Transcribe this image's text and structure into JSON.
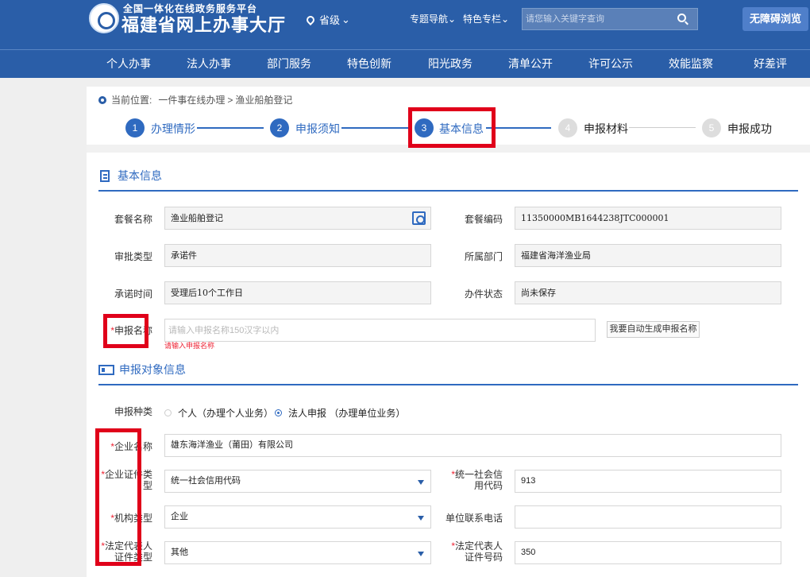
{
  "header": {
    "title_small": "全国一体化在线政务服务平台",
    "title_big": "福建省网上办事大厅",
    "region": "省级",
    "nav_topic": "专题导航",
    "nav_special": "特色专栏",
    "search_placeholder": "请您输入关键字查询",
    "accessibility": "无障碍浏览"
  },
  "main_nav": [
    "个人办事",
    "法人办事",
    "部门服务",
    "特色创新",
    "阳光政务",
    "清单公开",
    "许可公示",
    "效能监察",
    "好差评"
  ],
  "breadcrumb": {
    "prefix": "当前位置:",
    "path1": "一件事在线办理",
    "sep": ">",
    "path2": "渔业船舶登记"
  },
  "steps": [
    {
      "num": "1",
      "label": "办理情形"
    },
    {
      "num": "2",
      "label": "申报须知"
    },
    {
      "num": "3",
      "label": "基本信息"
    },
    {
      "num": "4",
      "label": "申报材料"
    },
    {
      "num": "5",
      "label": "申报成功"
    }
  ],
  "basic": {
    "title": "基本信息",
    "package_name_label": "套餐名称",
    "package_name": "渔业船舶登记",
    "package_code_label": "套餐编码",
    "package_code": "11350000MB1644238JTC000001",
    "approval_type_label": "审批类型",
    "approval_type": "承诺件",
    "department_label": "所属部门",
    "department": "福建省海洋渔业局",
    "promise_time_label": "承诺时间",
    "promise_time": "受理后10个工作日",
    "status_label": "办件状态",
    "status": "尚未保存",
    "apply_name_label": "申报名称",
    "apply_name_placeholder": "请输入申报名称150汉字以内",
    "apply_name_error": "请输入申报名称",
    "auto_generate": "我要自动生成申报名称"
  },
  "applicant": {
    "title": "申报对象信息",
    "type_label": "申报种类",
    "type_personal": "个人（办理个人业务）",
    "type_legal": "法人申报 （办理单位业务）",
    "company_label": "企业名称",
    "company": "雄东海洋渔业（莆田）有限公司",
    "cert_type_label1": "企业证件类",
    "cert_type_label2": "型",
    "cert_type": "统一社会信用代码",
    "credit_code_label1": "统一社会信",
    "credit_code_label2": "用代码",
    "credit_code": "913",
    "org_type_label": "机构类型",
    "org_type": "企业",
    "phone_label": "单位联系电话",
    "legal_cert_type_label1": "法定代表人",
    "legal_cert_type_label2": "证件类型",
    "legal_cert_type": "其他",
    "legal_cert_no_label1": "法定代表人",
    "legal_cert_no_label2": "证件号码",
    "legal_cert_no": "350"
  }
}
